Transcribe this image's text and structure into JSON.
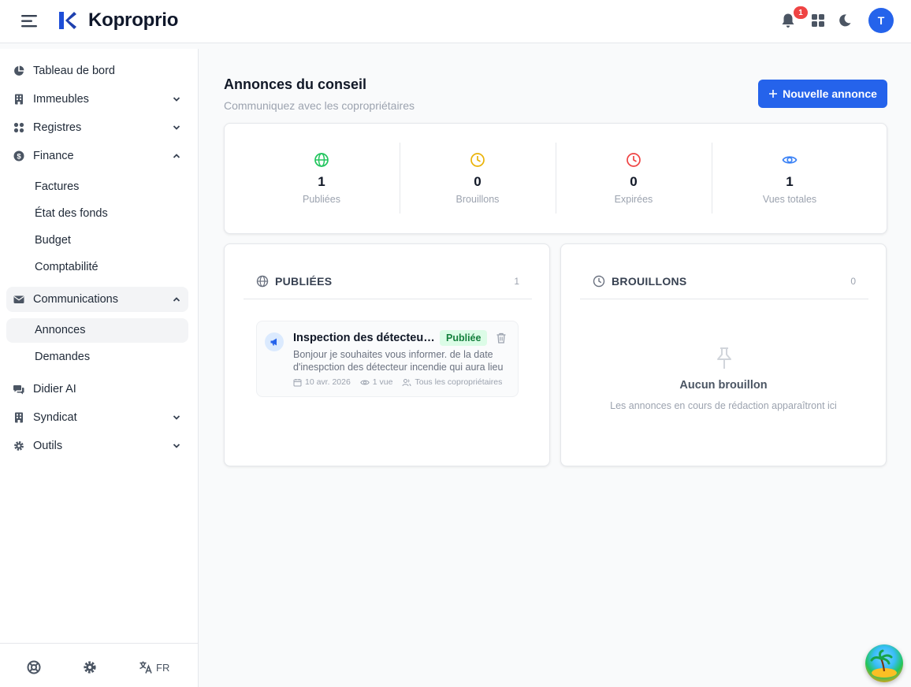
{
  "app": {
    "brand": "Koproprio",
    "notifications_count": "1",
    "avatar_initial": "T"
  },
  "sidebar": {
    "items": [
      {
        "label": "Tableau de bord",
        "icon": "pie-chart-icon"
      },
      {
        "label": "Immeubles",
        "icon": "building-icon",
        "expanded": false
      },
      {
        "label": "Registres",
        "icon": "grid-icon",
        "expanded": false
      },
      {
        "label": "Finance",
        "icon": "dollar-icon",
        "expanded": true,
        "children": [
          "Factures",
          "État des fonds",
          "Budget",
          "Comptabilité"
        ]
      },
      {
        "label": "Communications",
        "icon": "mail-icon",
        "expanded": true,
        "children": [
          "Annonces",
          "Demandes"
        ],
        "active_child": "Annonces"
      },
      {
        "label": "Didier AI",
        "icon": "chat-icon"
      },
      {
        "label": "Syndicat",
        "icon": "building-icon",
        "expanded": false
      },
      {
        "label": "Outils",
        "icon": "gear-icon",
        "expanded": false
      }
    ],
    "footer": {
      "language": "FR"
    }
  },
  "main": {
    "title": "Annonces du conseil",
    "subtitle": "Communiquez avec les copropriétaires",
    "new_button": "Nouvelle annonce",
    "stats": [
      {
        "value": "1",
        "label": "Publiées",
        "icon": "globe-icon",
        "color": "#22c55e"
      },
      {
        "value": "0",
        "label": "Brouillons",
        "icon": "clock-icon",
        "color": "#eab308"
      },
      {
        "value": "0",
        "label": "Expirées",
        "icon": "clock-icon",
        "color": "#ef4444"
      },
      {
        "value": "1",
        "label": "Vues totales",
        "icon": "eye-icon",
        "color": "#3b82f6"
      }
    ],
    "published": {
      "title": "PUBLIÉES",
      "count": "1",
      "items": [
        {
          "title": "Inspection des détecteurs incendie",
          "status": "Publiée",
          "body": "Bonjour je souhaites vous informer. de la date d'inespction des détecteur incendie qui aura lieu",
          "date": "10 avr. 2026",
          "views": "1 vue",
          "audience": "Tous les copropriétaires"
        }
      ]
    },
    "drafts": {
      "title": "BROUILLONS",
      "count": "0",
      "empty_title": "Aucun brouillon",
      "empty_subtitle": "Les annonces en cours de rédaction apparaîtront ici"
    }
  },
  "colors": {
    "primary": "#2563eb",
    "success_bg": "#dcfce7",
    "success_text": "#15803d",
    "danger": "#ef4444"
  }
}
